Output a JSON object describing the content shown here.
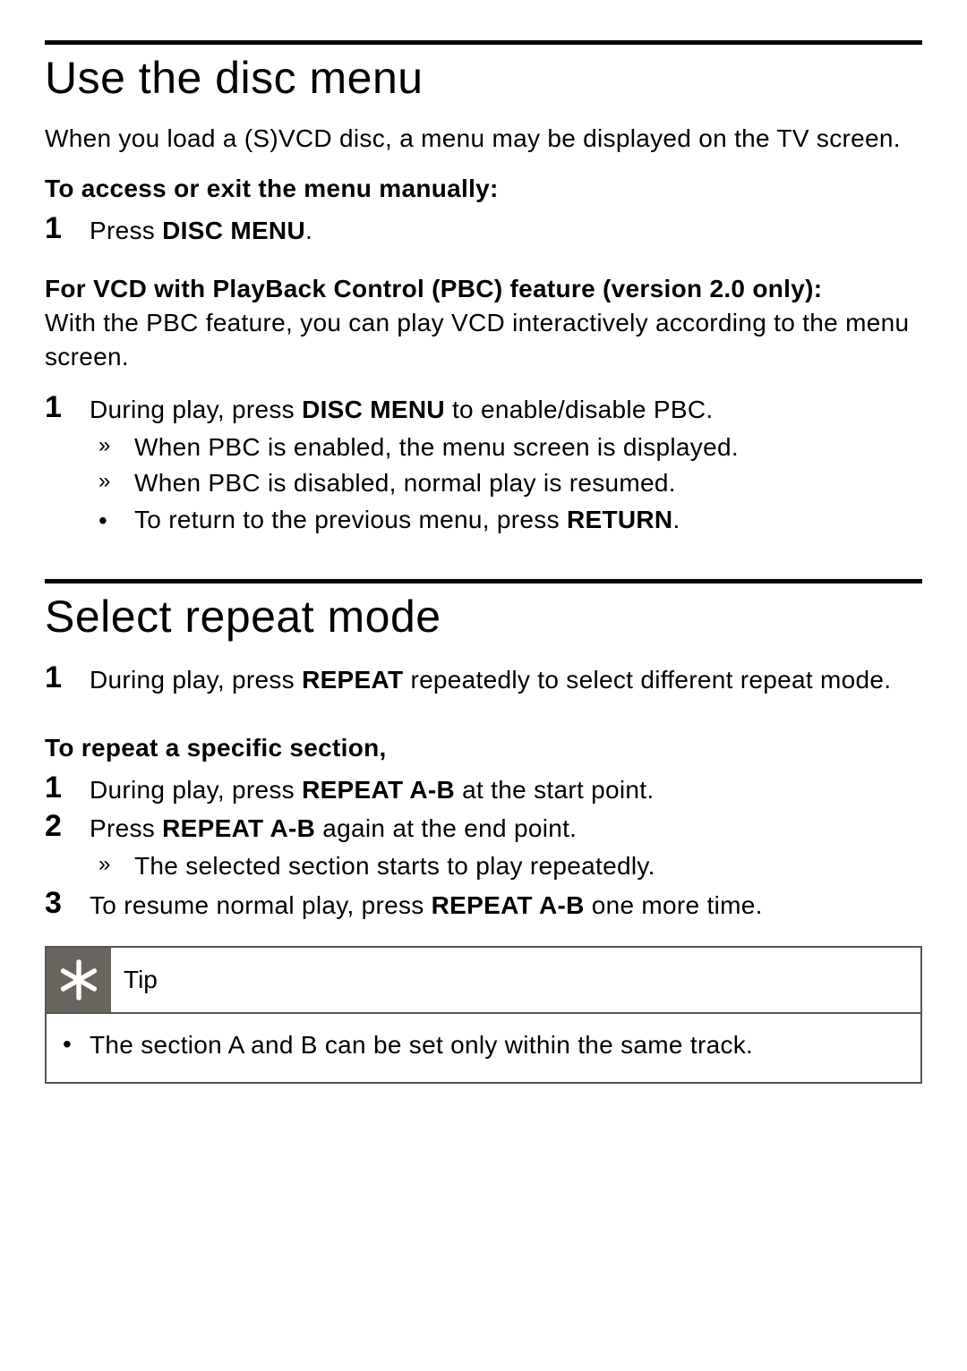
{
  "sec1": {
    "heading": "Use the disc menu",
    "intro": "When you load a (S)VCD disc, a menu may be displayed on the TV screen.",
    "sub1": "To access or exit the menu manually:",
    "step1_pre": "Press ",
    "step1_bold": "DISC MENU",
    "step1_post": ".",
    "sub2_bold": "For VCD with PlayBack Control (PBC) feature (version 2.0 only):",
    "sub2_text": "With the PBC feature, you can play VCD interactively according to the menu screen.",
    "pbc_step_pre": "During play, press ",
    "pbc_step_bold": "DISC MENU",
    "pbc_step_post": " to enable/disable PBC.",
    "pbc_sub_a": "When PBC is enabled, the menu screen is displayed.",
    "pbc_sub_b": "When PBC is disabled, normal play is resumed.",
    "pbc_sub_c_pre": "To return to the previous menu, press ",
    "pbc_sub_c_bold": "RETURN",
    "pbc_sub_c_post": "."
  },
  "sec2": {
    "heading": "Select repeat mode",
    "step1_pre": "During play, press ",
    "step1_bold": "REPEAT",
    "step1_post": " repeatedly to select different repeat mode.",
    "sub1": "To repeat a specific section,",
    "ab_step1_pre": "During play, press ",
    "ab_step1_bold": "REPEAT A-B",
    "ab_step1_post": " at the start point.",
    "ab_step2_pre": "Press ",
    "ab_step2_bold": "REPEAT A-B",
    "ab_step2_post": " again at the end point.",
    "ab_step2_sub": "The selected section starts to play repeatedly.",
    "ab_step3_pre": "To resume normal play, press ",
    "ab_step3_bold": "REPEAT A-B",
    "ab_step3_post": " one more time."
  },
  "tip": {
    "label": "Tip",
    "text": "The section A and B can be set only within the same track."
  },
  "nums": {
    "n1": "1",
    "n2": "2",
    "n3": "3"
  },
  "marks": {
    "arrow": "»",
    "bullet": "•"
  }
}
